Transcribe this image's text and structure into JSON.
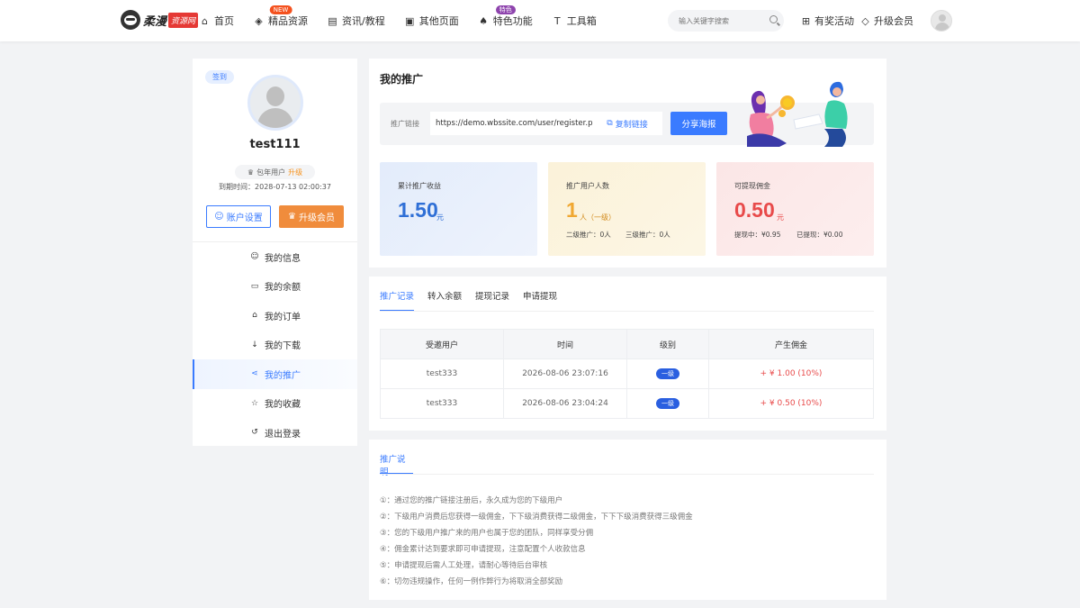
{
  "header": {
    "logo_text": "柔漫",
    "logo_tag": "资源网",
    "nav": [
      {
        "label": "首页",
        "icon": "home-icon",
        "badge": ""
      },
      {
        "label": "精品资源",
        "icon": "layers-icon",
        "badge": "NEW"
      },
      {
        "label": "资讯/教程",
        "icon": "document-icon",
        "badge": ""
      },
      {
        "label": "其他页面",
        "icon": "window-icon",
        "badge": ""
      },
      {
        "label": "特色功能",
        "icon": "rocket-icon",
        "badge": "特色"
      },
      {
        "label": "工具箱",
        "icon": "tool-icon",
        "badge": ""
      }
    ],
    "search_placeholder": "输入关键字搜索",
    "activity_label": "有奖活动",
    "vip_label": "升级会员"
  },
  "sidebar": {
    "signin_label": "签到",
    "username": "test111",
    "member_type": "包年用户",
    "upgrade_link": "升级",
    "expire_text": "到期时间：2028-07-13 02:00:37",
    "account_button": "账户设置",
    "upgrade_button": "升级会员",
    "menu": [
      {
        "label": "我的信息",
        "icon": "user-icon",
        "active": false
      },
      {
        "label": "我的余额",
        "icon": "wallet-icon",
        "active": false
      },
      {
        "label": "我的订单",
        "icon": "bag-icon",
        "active": false
      },
      {
        "label": "我的下载",
        "icon": "download-icon",
        "active": false
      },
      {
        "label": "我的推广",
        "icon": "share-icon",
        "active": true
      },
      {
        "label": "我的收藏",
        "icon": "star-icon",
        "active": false
      },
      {
        "label": "退出登录",
        "icon": "logout-icon",
        "active": false
      }
    ]
  },
  "promo": {
    "title": "我的推广",
    "link_label": "推广链接",
    "link_value": "https://demo.wbssite.com/user/register.php?r",
    "copy_button": "复制链接",
    "share_button": "分享海报",
    "stats": {
      "earnings": {
        "label": "累计推广收益",
        "value": "1.50",
        "unit": "元"
      },
      "users": {
        "label": "推广用户人数",
        "value": "1",
        "unit": "人（一级）",
        "sub1": "二级推广：0人",
        "sub2": "三级推广：0人"
      },
      "withdraw": {
        "label": "可提现佣金",
        "value": "0.50",
        "unit": "元",
        "sub1": "提现中：¥0.95",
        "sub2": "已提现：¥0.00"
      }
    }
  },
  "records": {
    "tabs": [
      "推广记录",
      "转入余额",
      "提现记录",
      "申请提现"
    ],
    "columns": [
      "受邀用户",
      "时间",
      "级别",
      "产生佣金"
    ],
    "rows": [
      {
        "user": "test333",
        "time": "2026-08-06 23:07:16",
        "level": "一级",
        "commission": "+ ¥ 1.00 (10%)"
      },
      {
        "user": "test333",
        "time": "2026-08-06 23:04:24",
        "level": "一级",
        "commission": "+ ¥ 0.50 (10%)"
      }
    ]
  },
  "description": {
    "tab": "推广说明",
    "items": [
      "①：通过您的推广链接注册后，永久成为您的下级用户",
      "②：下级用户消费后您获得一级佣金，下下级消费获得二级佣金，下下下级消费获得三级佣金",
      "③：您的下级用户推广来的用户也属于您的团队，同样享受分佣",
      "④：佣金累计达到要求即可申请提现，注意配置个人收款信息",
      "⑤：申请提现后需人工处理，请耐心等待后台审核",
      "⑥：切勿违规操作，任何一例作弊行为将取消全部奖励"
    ]
  },
  "colors": {
    "accent": "#3a7bff",
    "orange": "#f08c3c",
    "red": "#e84a4a",
    "yellow": "#f0a832"
  }
}
